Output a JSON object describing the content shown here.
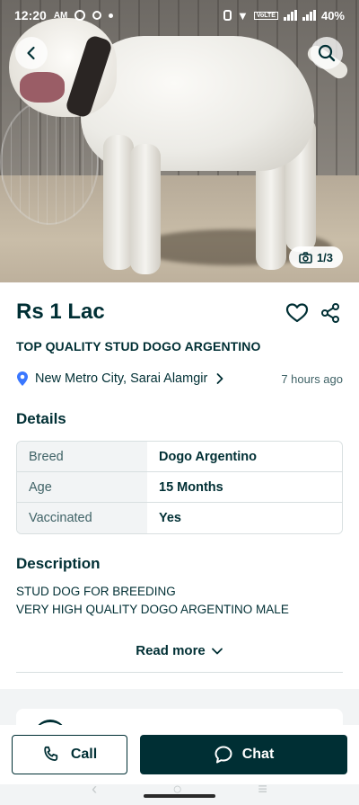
{
  "status_bar": {
    "time": "12:20",
    "am_label": "AM",
    "battery": "40%",
    "net_label": "VoLTE"
  },
  "gallery": {
    "photo_counter": "1/3"
  },
  "listing": {
    "price": "Rs 1 Lac",
    "title": "TOP QUALITY STUD DOGO ARGENTINO",
    "location": "New Metro City, Sarai Alamgir",
    "posted": "7 hours ago"
  },
  "details": {
    "heading": "Details",
    "rows": [
      {
        "key": "Breed",
        "value": "Dogo Argentino"
      },
      {
        "key": "Age",
        "value": "15 Months"
      },
      {
        "key": "Vaccinated",
        "value": "Yes"
      }
    ]
  },
  "description": {
    "heading": "Description",
    "lines": [
      "STUD DOG FOR BREEDING",
      "VERY HIGH QUALITY DOGO ARGENTINO MALE"
    ],
    "read_more": "Read more"
  },
  "actions": {
    "call_label": "Call",
    "chat_label": "Chat"
  },
  "colors": {
    "primary": "#002f34",
    "accent_pin": "#3a77ff",
    "muted": "#406367"
  }
}
